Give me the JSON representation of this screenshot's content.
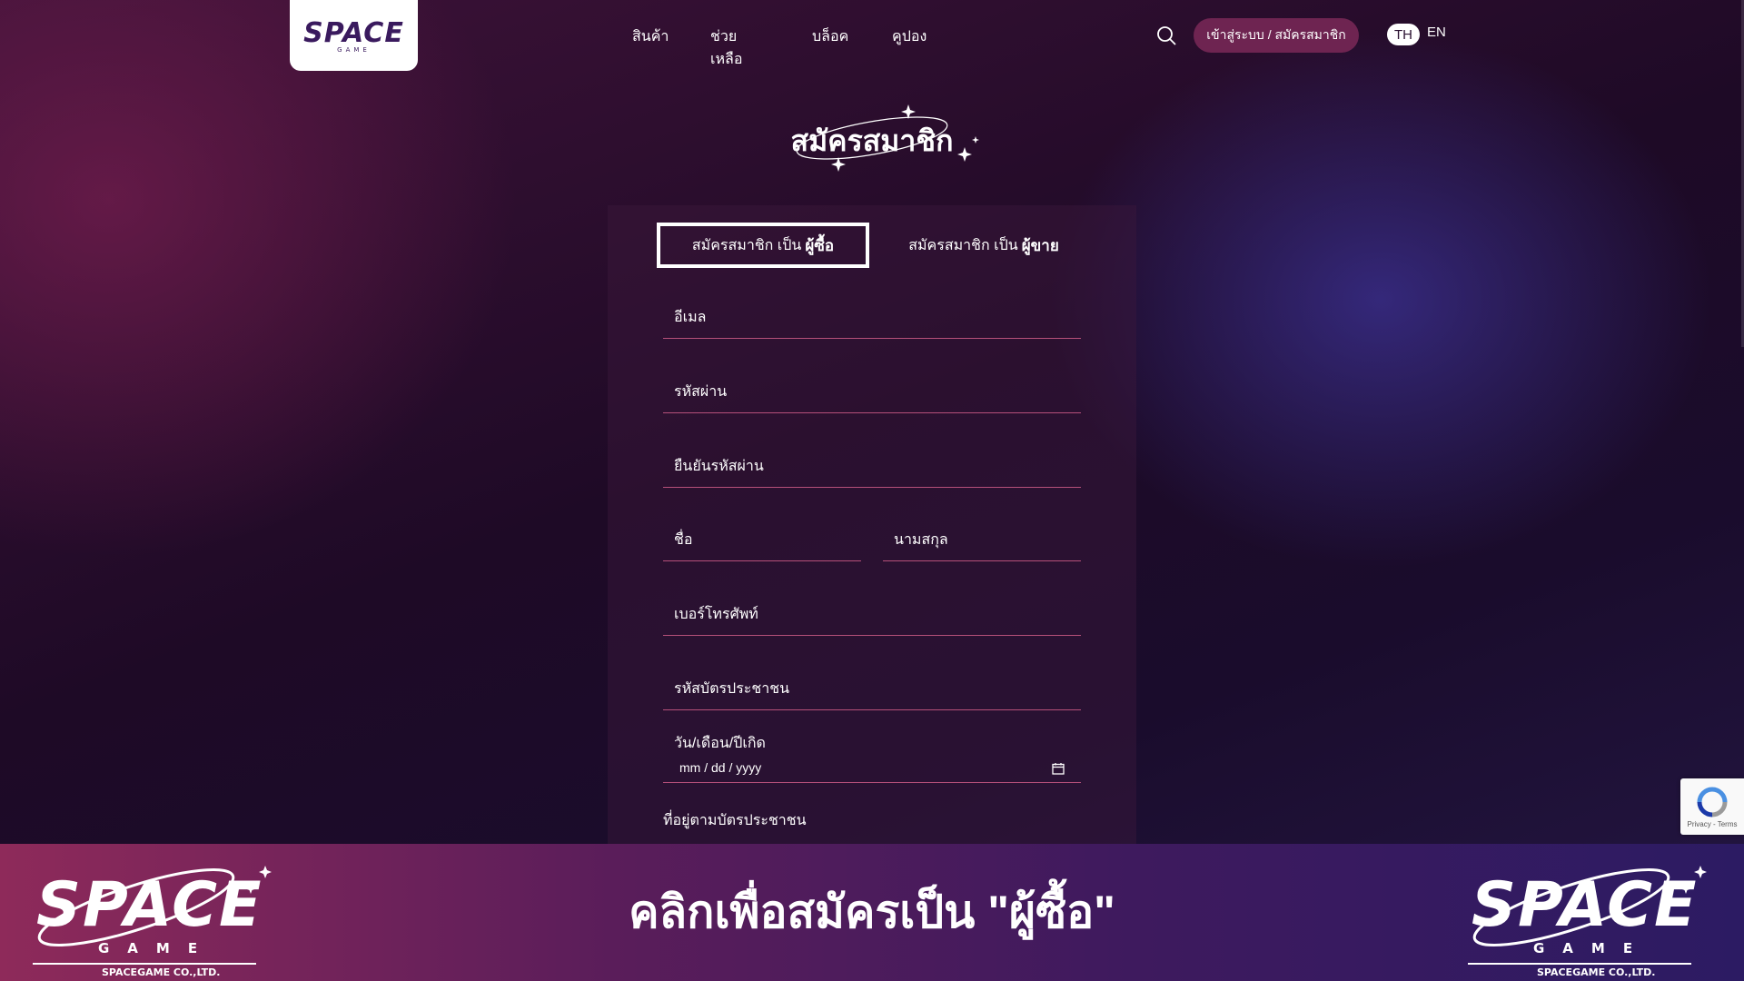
{
  "logo": {
    "word": "SPACE",
    "sub": "GAME"
  },
  "nav": {
    "items": [
      "สินค้า",
      "ช่วยเหลือ",
      "บล็อค",
      "คูปอง"
    ]
  },
  "header": {
    "login_label": "เข้าสู่ระบบ / สมัครสมาชิก",
    "lang_th": "TH",
    "lang_en": "EN"
  },
  "page": {
    "title": "สมัครสมาชิก"
  },
  "tabs": {
    "buyer_prefix": "สมัครสมาชิก เป็น",
    "buyer_bold": "ผู้ซื้อ",
    "seller_prefix": "สมัครสมาชิก เป็น",
    "seller_bold": "ผู้ขาย"
  },
  "form": {
    "email": "อีเมล",
    "password": "รหัสผ่าน",
    "confirm_password": "ยืนยันรหัสผ่าน",
    "first_name": "ชื่อ",
    "last_name": "นามสกุล",
    "phone": "เบอร์โทรศัพท์",
    "id_card": "รหัสบัตรประชาชน",
    "dob_label": "วัน/เดือน/ปีเกิด",
    "dob_placeholder": "mm / dd / yyyy",
    "address": "ที่อยู่ตามบัตรประชาชน"
  },
  "recaptcha": {
    "text": "Privacy - Terms"
  },
  "banner": {
    "text": "คลิกเพื่อสมัครเป็น \"ผู้ซื้อ\"",
    "logo_word": "SPACE",
    "logo_game": "GAME",
    "logo_company": "SPACEGAME CO.,LTD."
  },
  "colors": {
    "accent": "#b6507a",
    "login_button": "#6e2451",
    "background_dark": "#1e0a26"
  }
}
